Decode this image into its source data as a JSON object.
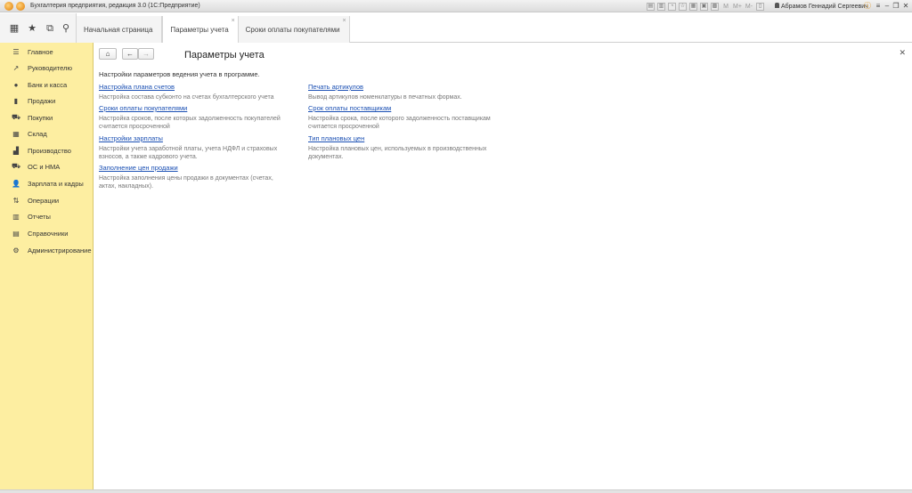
{
  "window": {
    "title": "Бухгалтерия предприятия, редакция 3.0  (1С:Предприятие)",
    "user": "Абрамов Геннадий Сергеевич",
    "tools": [
      "M",
      "M+",
      "M-"
    ]
  },
  "tabs": [
    {
      "label": "Начальная страница"
    },
    {
      "label": "Параметры учета"
    },
    {
      "label": "Сроки оплаты покупателями"
    }
  ],
  "sidebar": {
    "items": [
      {
        "label": "Главное"
      },
      {
        "label": "Руководителю"
      },
      {
        "label": "Банк и касса"
      },
      {
        "label": "Продажи"
      },
      {
        "label": "Покупки"
      },
      {
        "label": "Склад"
      },
      {
        "label": "Производство"
      },
      {
        "label": "ОС и НМА"
      },
      {
        "label": "Зарплата и кадры"
      },
      {
        "label": "Операции"
      },
      {
        "label": "Отчеты"
      },
      {
        "label": "Справочники"
      },
      {
        "label": "Администрирование"
      }
    ]
  },
  "page": {
    "title": "Параметры учета",
    "intro": "Настройки параметров ведения учета в программе.",
    "left": [
      {
        "link": "Настройка плана счетов",
        "desc": "Настройка состава субконто на счетах бухгалтерского учета"
      },
      {
        "link": "Сроки оплаты покупателями",
        "desc": "Настройка сроков, после которых задолженность покупателей считается просроченной"
      },
      {
        "link": "Настройки зарплаты",
        "desc": "Настройки учета заработной платы, учета НДФЛ и страховых взносов, а также кадрового учета."
      },
      {
        "link": "Заполнение цен продажи",
        "desc": "Настройка заполнения цены продажи в документах (счетах, актах, накладных)."
      }
    ],
    "right": [
      {
        "link": "Печать артикулов",
        "desc": "Вывод артикулов номенклатуры в печатных формах."
      },
      {
        "link": "Срок оплаты поставщикам",
        "desc": "Настройка срока, после которого задолженность поставщикам считается просроченной"
      },
      {
        "link": "Тип плановых цен",
        "desc": "Настройка плановых цен, используемых в производственных документах."
      }
    ]
  }
}
